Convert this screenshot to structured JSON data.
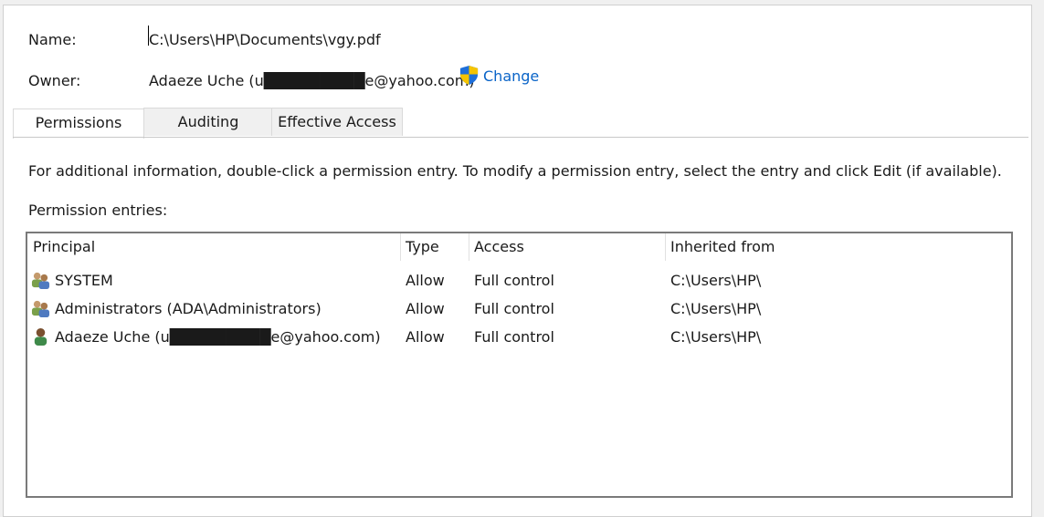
{
  "fields": {
    "name_label": "Name:",
    "name_value": "C:\\Users\\HP\\Documents\\vgy.pdf",
    "owner_label": "Owner:",
    "owner_value": "Adaeze Uche (u█████████e@yahoo.com)",
    "change_label": "Change",
    "change_icon": "uac-shield-icon"
  },
  "tabs": [
    {
      "label": "Permissions",
      "active": true
    },
    {
      "label": "Auditing",
      "active": false
    },
    {
      "label": "Effective Access",
      "active": false
    }
  ],
  "info_text": "For additional information, double-click a permission entry. To modify a permission entry, select the entry and click Edit (if available).",
  "entries_label": "Permission entries:",
  "columns": [
    "Principal",
    "Type",
    "Access",
    "Inherited from"
  ],
  "entries": [
    {
      "icon": "group-icon",
      "principal": "SYSTEM",
      "type": "Allow",
      "access": "Full control",
      "inherited": "C:\\Users\\HP\\"
    },
    {
      "icon": "group-icon",
      "principal": "Administrators (ADA\\Administrators)",
      "type": "Allow",
      "access": "Full control",
      "inherited": "C:\\Users\\HP\\"
    },
    {
      "icon": "user-icon",
      "principal": "Adaeze Uche (u█████████e@yahoo.com)",
      "type": "Allow",
      "access": "Full control",
      "inherited": "C:\\Users\\HP\\"
    }
  ],
  "colors": {
    "link": "#0a64c8",
    "shield_blue": "#1e6fd9",
    "shield_yellow": "#f5c400"
  }
}
